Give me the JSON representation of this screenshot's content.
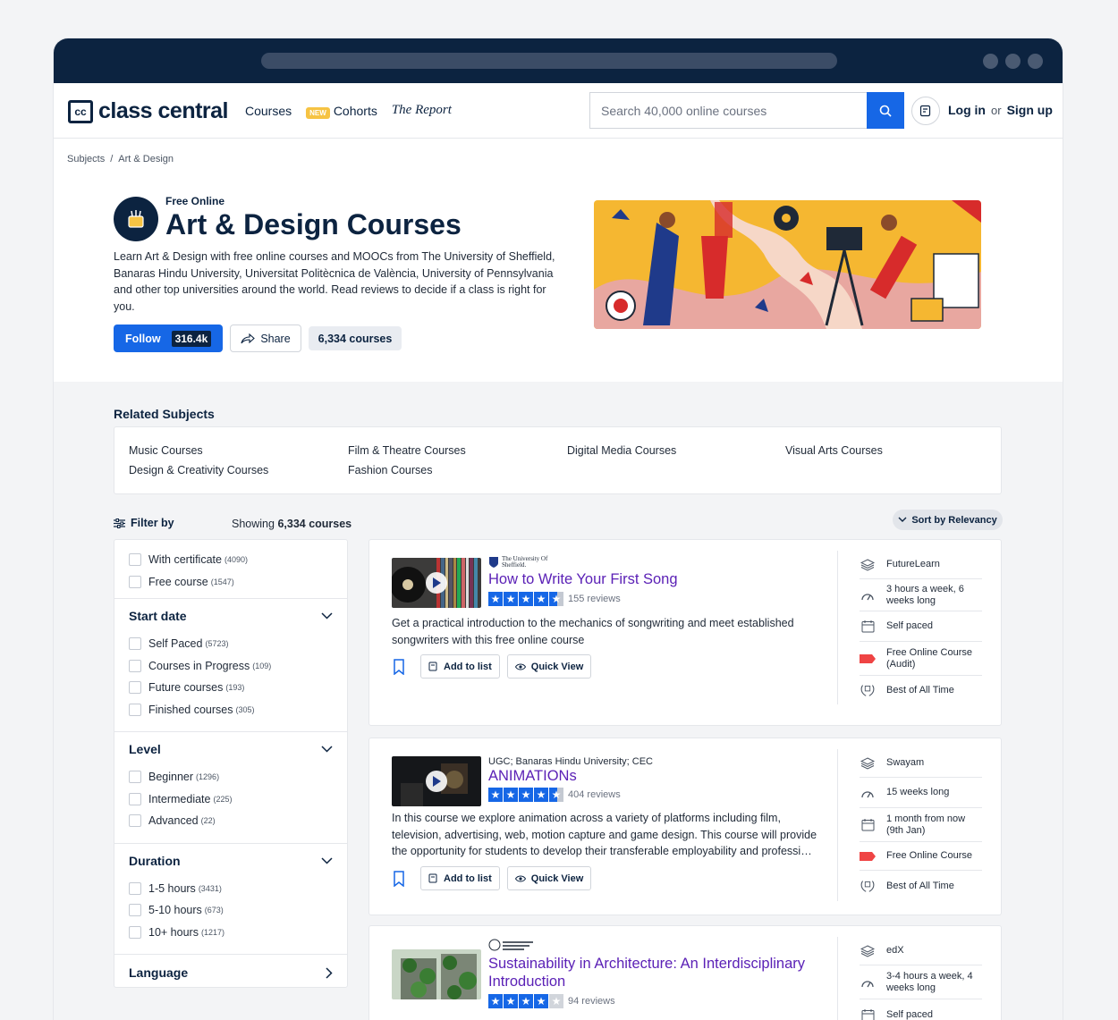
{
  "header": {
    "logo_mark": "cc",
    "logo_text": "class central",
    "nav": [
      "Courses",
      "Cohorts",
      "The Report"
    ],
    "new_badge": "NEW",
    "search_placeholder": "Search 40,000 online courses",
    "login": "Log in",
    "or": "or",
    "signup": "Sign up"
  },
  "breadcrumb": [
    "Subjects",
    "/",
    "Art & Design"
  ],
  "hero": {
    "pre_title": "Free Online",
    "title": "Art & Design Courses",
    "description": "Learn Art & Design with free online courses and MOOCs from The University of Sheffield, Banaras Hindu University, Universitat Politècnica de València, University of Pennsylvania and other top universities around the world. Read reviews to decide if a class is right for you.",
    "follow_label": "Follow",
    "follow_count": "316.4k",
    "share_label": "Share",
    "course_count": "6,334 courses"
  },
  "related": {
    "title": "Related Subjects",
    "items": [
      "Music Courses",
      "Design & Creativity Courses",
      "Film & Theatre Courses",
      "Fashion Courses",
      "Digital Media Courses",
      "Visual Arts Courses"
    ]
  },
  "filters": {
    "title": "Filter by",
    "showing_prefix": "Showing",
    "showing_count": "6,334 courses",
    "sort_label": "Sort by Relevancy",
    "top": [
      {
        "label": "With certificate",
        "count": "(4090)"
      },
      {
        "label": "Free course",
        "count": "(1547)"
      }
    ],
    "start_date": {
      "title": "Start date",
      "options": [
        {
          "label": "Self Paced",
          "count": "(5723)"
        },
        {
          "label": "Courses in Progress",
          "count": "(109)"
        },
        {
          "label": "Future courses",
          "count": "(193)"
        },
        {
          "label": "Finished courses",
          "count": "(305)"
        }
      ]
    },
    "level": {
      "title": "Level",
      "options": [
        {
          "label": "Beginner",
          "count": "(1296)"
        },
        {
          "label": "Intermediate",
          "count": "(225)"
        },
        {
          "label": "Advanced",
          "count": "(22)"
        }
      ]
    },
    "duration": {
      "title": "Duration",
      "options": [
        {
          "label": "1-5 hours",
          "count": "(3431)"
        },
        {
          "label": "5-10 hours",
          "count": "(673)"
        },
        {
          "label": "10+ hours",
          "count": "(1217)"
        }
      ]
    },
    "language": {
      "title": "Language"
    }
  },
  "courses": [
    {
      "provider": "The University Of Sheffield.",
      "title": "How to Write Your First Song",
      "rating": 4.5,
      "reviews": "155 reviews",
      "description": "Get a practical introduction to the mechanics of songwriting and meet established songwriters with this free online course",
      "add_label": "Add to list",
      "quick_label": "Quick View",
      "meta": [
        "FutureLearn",
        "3 hours a week, 6 weeks long",
        "Self paced",
        "Free Online Course (Audit)",
        "Best of All Time"
      ]
    },
    {
      "provider": "UGC;  Banaras Hindu University;  CEC",
      "title": "ANIMATIONs",
      "rating": 4.5,
      "reviews": "404 reviews",
      "description": "In this course we explore animation across a variety of platforms including film, television, advertising, web, motion capture and game design. This course will provide the opportunity for students to develop their transferable employability and professi…",
      "add_label": "Add to list",
      "quick_label": "Quick View",
      "meta": [
        "Swayam",
        "15 weeks long",
        "1 month from now (9th Jan)",
        "Free Online Course",
        "Best of All Time"
      ]
    },
    {
      "provider": "",
      "title": "Sustainability in Architecture: An Interdisciplinary Introduction",
      "rating": 4,
      "reviews": "94 reviews",
      "meta": [
        "edX",
        "3-4 hours a week, 4 weeks long",
        "Self paced"
      ]
    }
  ],
  "colors": {
    "brand": "#0c2340",
    "accent": "#1667e6",
    "title_link": "#5b21b6"
  }
}
